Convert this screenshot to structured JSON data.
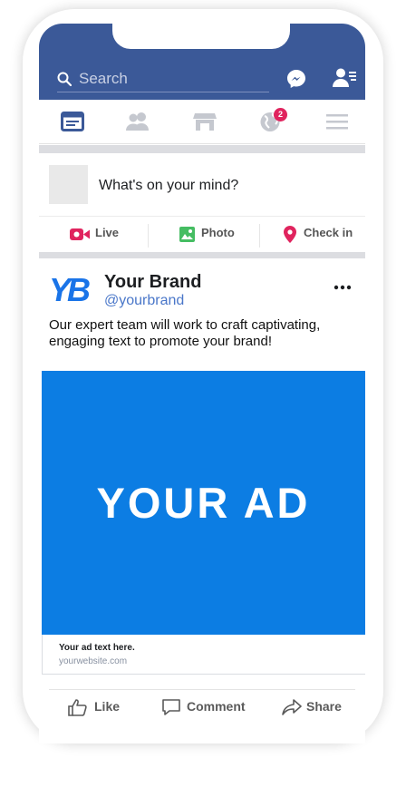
{
  "search": {
    "placeholder": "Search"
  },
  "icons": {
    "search": "search-icon",
    "messenger": "messenger-icon",
    "friend_requests": "friend-requests-icon",
    "news_feed": "news-feed-icon",
    "friends": "friends-icon",
    "marketplace": "marketplace-icon",
    "notifications": "globe-notifications-icon",
    "menu": "hamburger-menu-icon"
  },
  "nav": {
    "notification_count": "2"
  },
  "composer": {
    "prompt": "What's on your mind?",
    "actions": [
      {
        "label": "Live",
        "icon": "live-video-icon",
        "color": "#e0245e"
      },
      {
        "label": "Photo",
        "icon": "photo-icon",
        "color": "#45bd62"
      },
      {
        "label": "Check in",
        "icon": "location-pin-icon",
        "color": "#e0245e"
      }
    ]
  },
  "post": {
    "logo_text": "YB",
    "brand_name": "Your Brand",
    "handle": "@yourbrand",
    "text": "Our expert team will work to craft captivating, engaging text to promote your brand!",
    "ad_image_text": "YOUR AD",
    "ad_caption": "Your ad text here.",
    "ad_url": "yourwebsite.com"
  },
  "reactions": {
    "like": "Like",
    "comment": "Comment",
    "share": "Share"
  },
  "colors": {
    "header": "#3b5998",
    "ad_background": "#0c7de3",
    "brand_blue": "#1a74e8"
  }
}
